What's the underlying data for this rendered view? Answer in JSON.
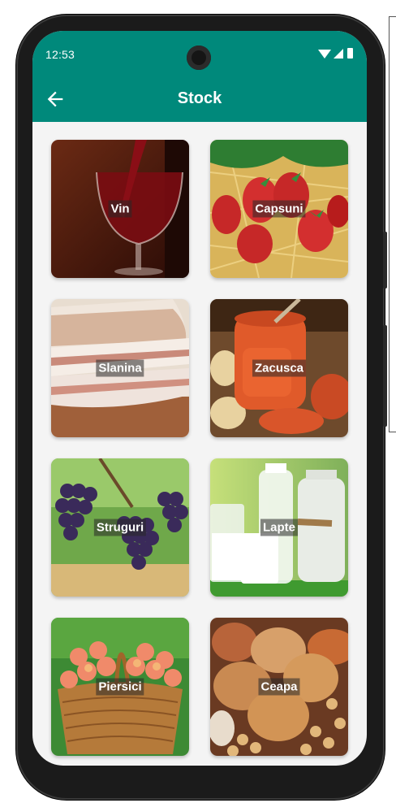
{
  "status": {
    "time": "12:53"
  },
  "appbar": {
    "title": "Stock",
    "back_icon": "arrow-left-icon",
    "color": "#00897b"
  },
  "products": [
    {
      "label": "Vin"
    },
    {
      "label": "Capsuni"
    },
    {
      "label": "Slanina"
    },
    {
      "label": "Zacusca"
    },
    {
      "label": "Struguri"
    },
    {
      "label": "Lapte"
    },
    {
      "label": "Piersici"
    },
    {
      "label": "Ceapa"
    }
  ]
}
